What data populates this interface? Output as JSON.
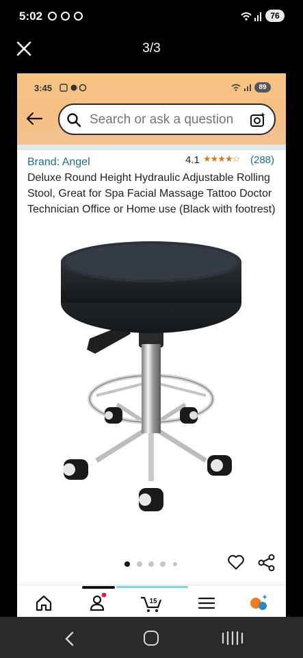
{
  "outer_status": {
    "time": "5:02",
    "battery": "76"
  },
  "viewer": {
    "page_indicator": "3/3"
  },
  "inner_status": {
    "time": "3:45",
    "battery": "89"
  },
  "search": {
    "placeholder": "Search or ask a question"
  },
  "product": {
    "brand": "Brand: Angel",
    "rating": "4.1",
    "stars": "★★★★☆",
    "review_count": "(288)",
    "title": "Deluxe Round Height Hydraulic Adjustable Rolling Stool, Great for Spa Facial Massage Tattoo Doctor Technician Office or Home use (Black with footrest)",
    "image_count": 5,
    "active_image_index": 0
  },
  "bottom_nav": {
    "cart_count": "15"
  },
  "colors": {
    "header_orange": "#f5bf85",
    "link_teal": "#1f6d86",
    "star_orange": "#d47b14"
  }
}
